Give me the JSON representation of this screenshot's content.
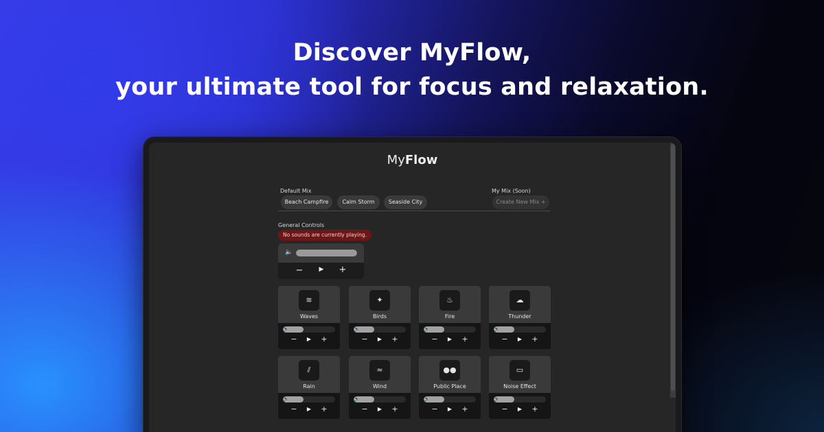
{
  "headline": {
    "line1": "Discover MyFlow,",
    "line2": "your ultimate tool for focus and relaxation."
  },
  "app": {
    "logo_light": "My",
    "logo_bold": "Flow",
    "default_mix": {
      "label": "Default Mix",
      "presets": [
        "Beach Campfire",
        "Calm Storm",
        "Seaside City"
      ]
    },
    "my_mix": {
      "label": "My Mix (Soon)",
      "create_label": "Create New Mix +"
    },
    "general_controls": {
      "label": "General Controls",
      "status": "No sounds are currently playing.",
      "volume_percent": 100,
      "minus": "−",
      "play": "▶",
      "plus": "+"
    },
    "sounds": [
      {
        "name": "Waves",
        "icon": "waves-icon",
        "glyph": "≋",
        "volume_percent": 40
      },
      {
        "name": "Birds",
        "icon": "bird-icon",
        "glyph": "✦",
        "volume_percent": 40
      },
      {
        "name": "Fire",
        "icon": "fire-icon",
        "glyph": "♨",
        "volume_percent": 40
      },
      {
        "name": "Thunder",
        "icon": "thunder-cloud-icon",
        "glyph": "☁",
        "volume_percent": 40
      },
      {
        "name": "Rain",
        "icon": "rain-icon",
        "glyph": "⫽",
        "volume_percent": 40
      },
      {
        "name": "Wind",
        "icon": "wind-icon",
        "glyph": "≈",
        "volume_percent": 40
      },
      {
        "name": "Public Place",
        "icon": "people-icon",
        "glyph": "●●",
        "volume_percent": 40
      },
      {
        "name": "Noise Effect",
        "icon": "tv-icon",
        "glyph": "▭",
        "volume_percent": 40
      }
    ],
    "volume_glyph": "🔈",
    "colors": {
      "status_bg": "#6e1616",
      "panel": "#262626",
      "card": "#3a3a3a"
    }
  }
}
